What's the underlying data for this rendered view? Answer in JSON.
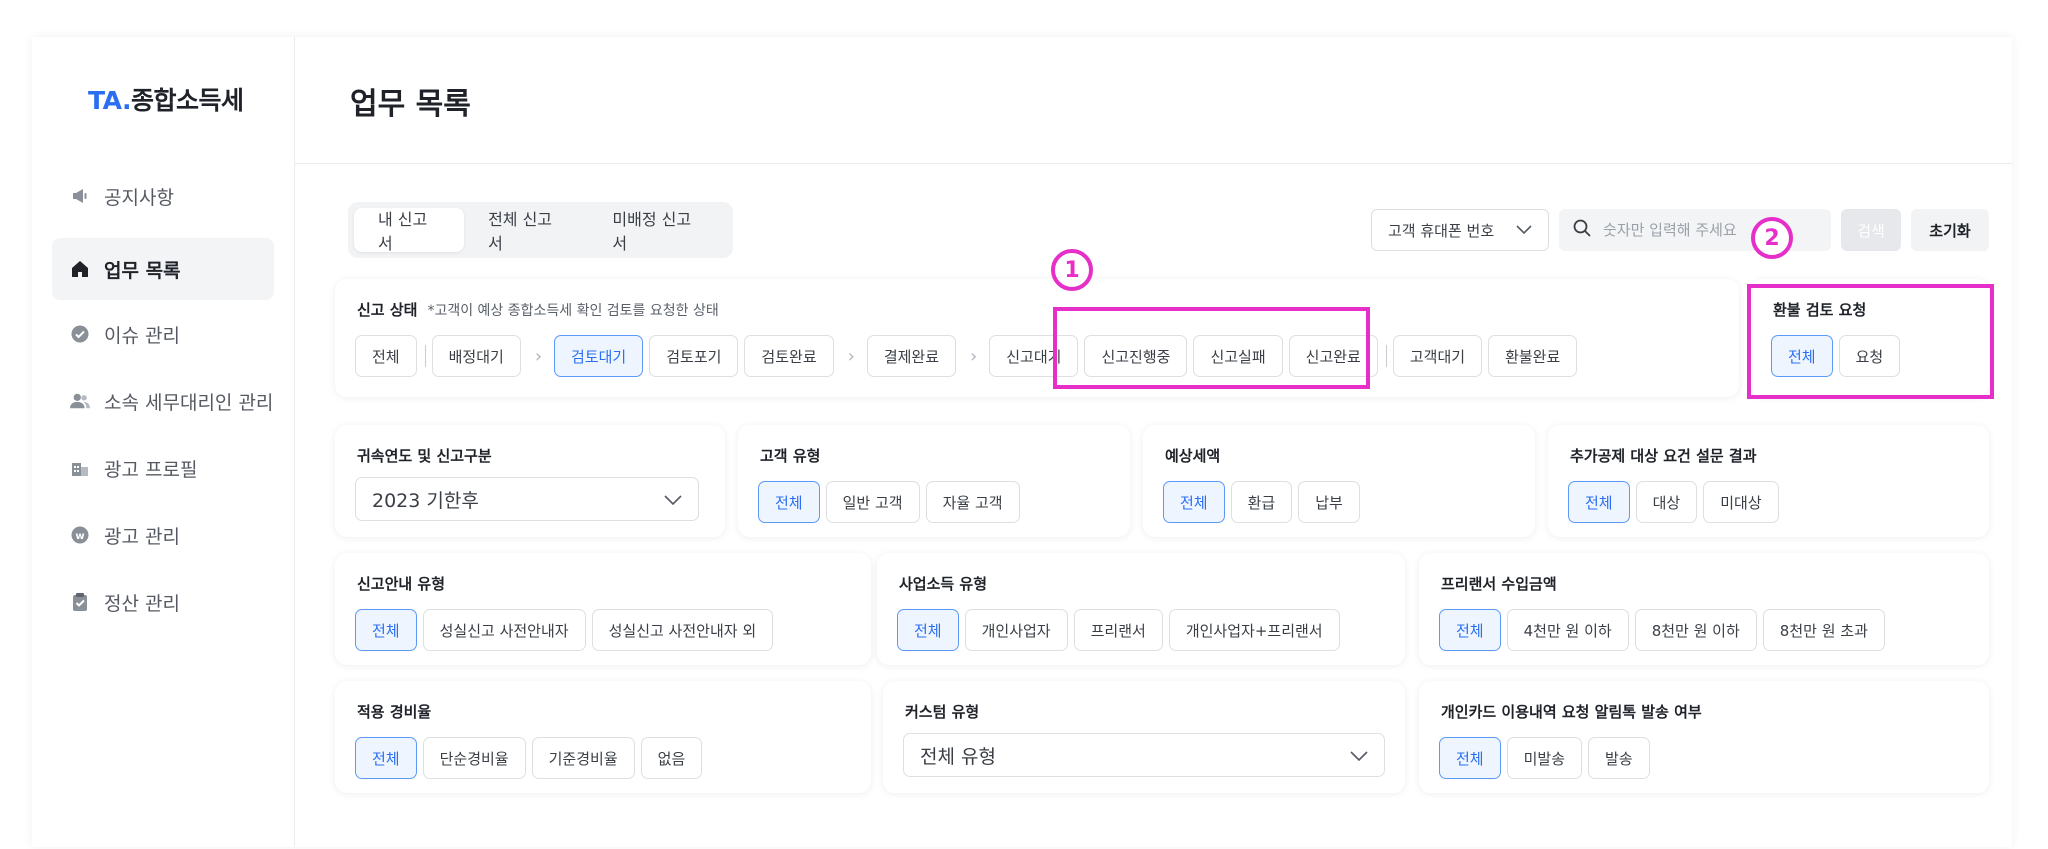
{
  "sidebar": {
    "logo": {
      "ta": "TA",
      "dot": ".",
      "rest": "종합소득세"
    },
    "items": [
      {
        "label": "공지사항",
        "icon": "megaphone-icon",
        "active": false
      },
      {
        "label": "업무 목록",
        "icon": "home-icon",
        "active": true
      },
      {
        "label": "이슈 관리",
        "icon": "check-circle-icon",
        "active": false
      },
      {
        "label": "소속 세무대리인 관리",
        "icon": "users-icon",
        "active": false
      },
      {
        "label": "광고 프로필",
        "icon": "building-icon",
        "active": false
      },
      {
        "label": "광고 관리",
        "icon": "ad-circle-icon",
        "active": false
      },
      {
        "label": "정산 관리",
        "icon": "clipboard-icon",
        "active": false
      }
    ]
  },
  "header": {
    "title": "업무 목록"
  },
  "tabs": [
    "내 신고서",
    "전체 신고서",
    "미배정 신고서"
  ],
  "search": {
    "select_value": "고객 휴대폰 번호",
    "placeholder": "숫자만 입력해 주세요",
    "search_label": "검색",
    "reset_label": "초기화"
  },
  "status_filter": {
    "title": "신고 상태",
    "note": "*고객이 예상 종합소득세 확인 검토를 요청한 상태",
    "chips": [
      "전체",
      "배정대기",
      "검토대기",
      "검토포기",
      "검토완료",
      "결제완료",
      "신고대기",
      "신고진행중",
      "신고실패",
      "신고완료",
      "고객대기",
      "환불완료"
    ],
    "selected": "검토대기"
  },
  "refund_filter": {
    "title": "환불 검토 요청",
    "chips": [
      "전체",
      "요청"
    ]
  },
  "row2": {
    "year": {
      "title": "귀속연도 및 신고구분",
      "value": "2023 기한후"
    },
    "customer_type": {
      "title": "고객 유형",
      "chips": [
        "전체",
        "일반 고객",
        "자율 고객"
      ]
    },
    "expected_tax": {
      "title": "예상세액",
      "chips": [
        "전체",
        "환급",
        "납부"
      ]
    },
    "survey": {
      "title": "추가공제 대상 요건 설문 결과",
      "chips": [
        "전체",
        "대상",
        "미대상"
      ]
    }
  },
  "row3": {
    "guide_type": {
      "title": "신고안내 유형",
      "chips": [
        "전체",
        "성실신고 사전안내자",
        "성실신고 사전안내자 외"
      ]
    },
    "business_type": {
      "title": "사업소득 유형",
      "chips": [
        "전체",
        "개인사업자",
        "프리랜서",
        "개인사업자+프리랜서"
      ]
    },
    "freelancer_income": {
      "title": "프리랜서 수입금액",
      "chips": [
        "전체",
        "4천만 원 이하",
        "8천만 원 이하",
        "8천만 원 초과"
      ]
    }
  },
  "row4": {
    "expense_rate": {
      "title": "적용 경비율",
      "chips": [
        "전체",
        "단순경비율",
        "기준경비율",
        "없음"
      ]
    },
    "custom_type": {
      "title": "커스텀 유형",
      "value": "전체 유형"
    },
    "card_notice": {
      "title": "개인카드 이용내역 요청 알림톡 발송 여부",
      "chips": [
        "전체",
        "미발송",
        "발송"
      ]
    }
  },
  "annotations": {
    "marker1": "1",
    "marker2": "2",
    "color": "#e62ec8"
  },
  "colors": {
    "accent": "#2a6ff3",
    "highlight": "#e62ec8"
  }
}
